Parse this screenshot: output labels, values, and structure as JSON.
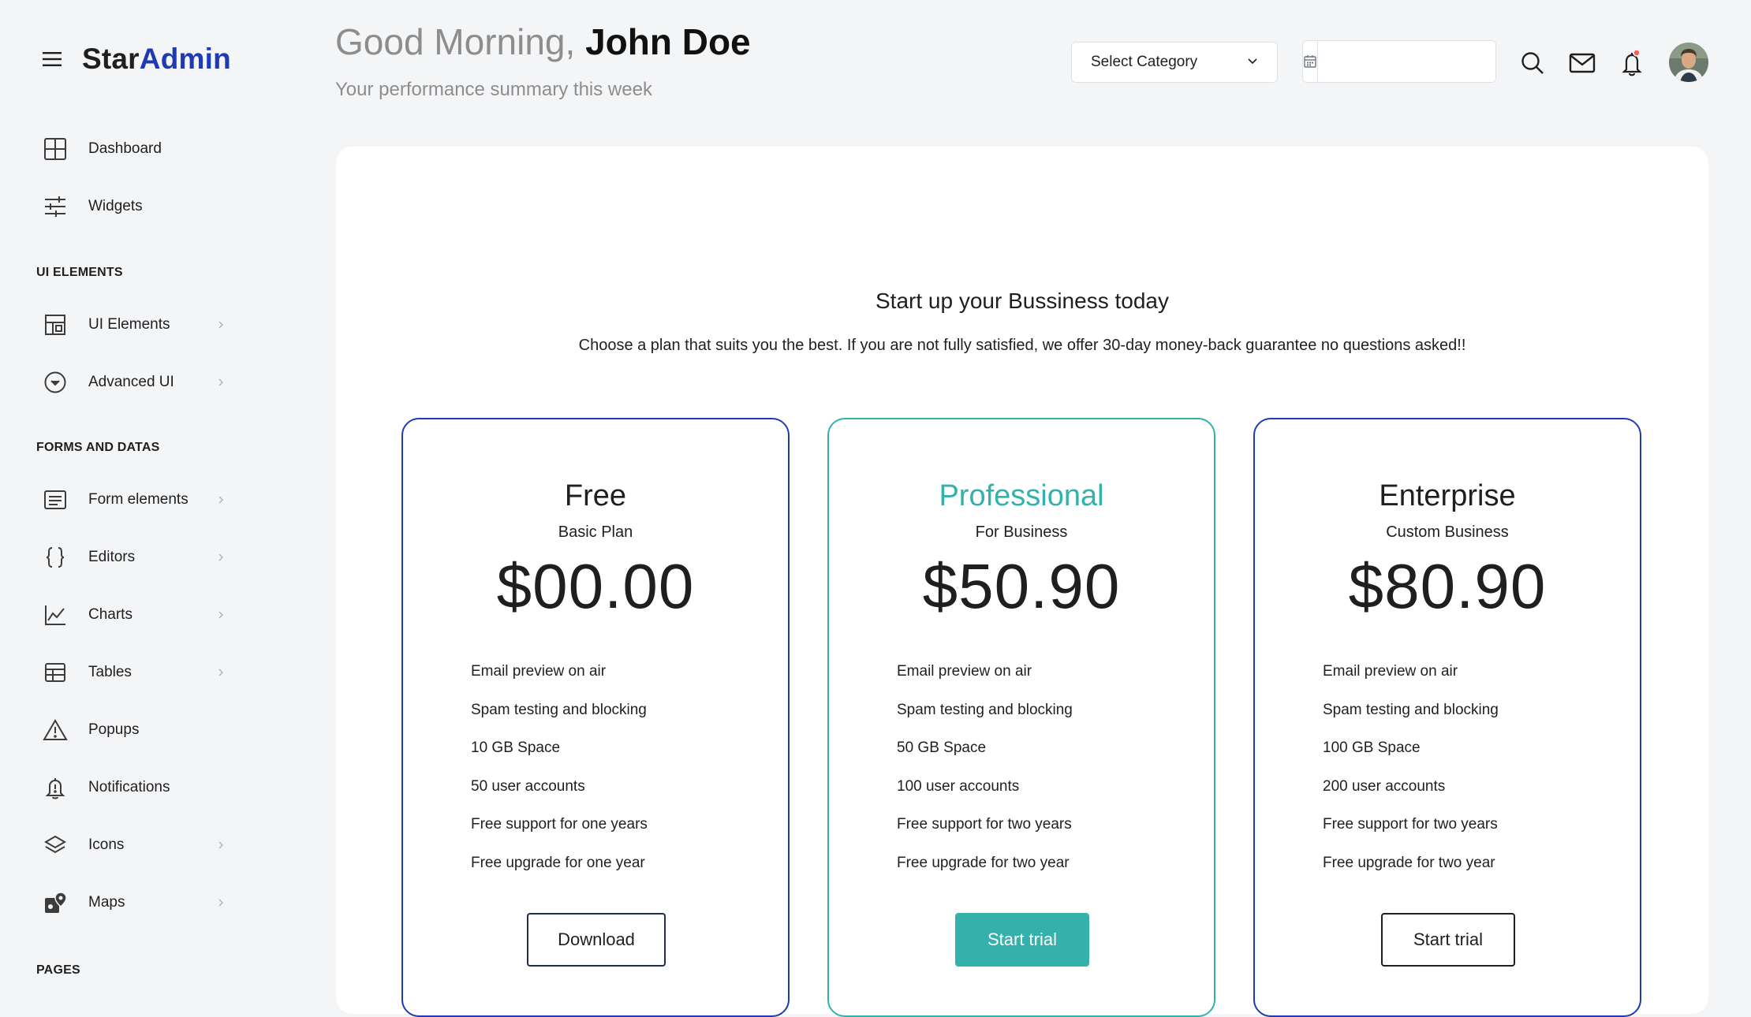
{
  "brand": {
    "part1": "Star",
    "part2": "Admin"
  },
  "header": {
    "greeting_prefix": "Good Morning, ",
    "user_name": "John Doe",
    "subtitle": "Your performance summary this week",
    "category_select": "Select Category",
    "date_value": ""
  },
  "sidebar": {
    "items_top": [
      {
        "label": "Dashboard",
        "icon": "grid-icon"
      },
      {
        "label": "Widgets",
        "icon": "sliders-icon"
      }
    ],
    "section_ui": "UI ELEMENTS",
    "items_ui": [
      {
        "label": "UI Elements",
        "icon": "layout-icon"
      },
      {
        "label": "Advanced UI",
        "icon": "chevron-circle-icon"
      }
    ],
    "section_forms": "FORMS AND DATAS",
    "items_forms": [
      {
        "label": "Form elements",
        "icon": "form-icon"
      },
      {
        "label": "Editors",
        "icon": "braces-icon"
      },
      {
        "label": "Charts",
        "icon": "line-chart-icon"
      },
      {
        "label": "Tables",
        "icon": "table-icon"
      },
      {
        "label": "Popups",
        "icon": "warning-icon"
      },
      {
        "label": "Notifications",
        "icon": "bell-alert-icon"
      },
      {
        "label": "Icons",
        "icon": "layers-icon"
      },
      {
        "label": "Maps",
        "icon": "map-marker-icon"
      }
    ],
    "section_pages": "PAGES"
  },
  "pricing": {
    "heading": "Start up your Bussiness today",
    "lead": "Choose a plan that suits you the best. If you are not fully satisfied, we offer 30-day money-back guarantee no questions asked!!",
    "plans": [
      {
        "name": "Free",
        "subtitle": "Basic Plan",
        "price": "$00.00",
        "features": [
          "Email preview on air",
          "Spam testing and blocking",
          "10 GB Space",
          "50 user accounts",
          "Free support for one years",
          "Free upgrade for one year"
        ],
        "button": "Download"
      },
      {
        "name": "Professional",
        "subtitle": "For Business",
        "price": "$50.90",
        "features": [
          "Email preview on air",
          "Spam testing and blocking",
          "50 GB Space",
          "100 user accounts",
          "Free support for two years",
          "Free upgrade for two year"
        ],
        "button": "Start trial"
      },
      {
        "name": "Enterprise",
        "subtitle": "Custom Business",
        "price": "$80.90",
        "features": [
          "Email preview on air",
          "Spam testing and blocking",
          "100 GB Space",
          "200 user accounts",
          "Free support for two years",
          "Free upgrade for two year"
        ],
        "button": "Start trial"
      }
    ]
  },
  "colors": {
    "brand_blue": "#1f3bb3",
    "teal": "#34b1aa",
    "page_bg": "#f4f5f7",
    "notification_dot": "#f95f53"
  }
}
